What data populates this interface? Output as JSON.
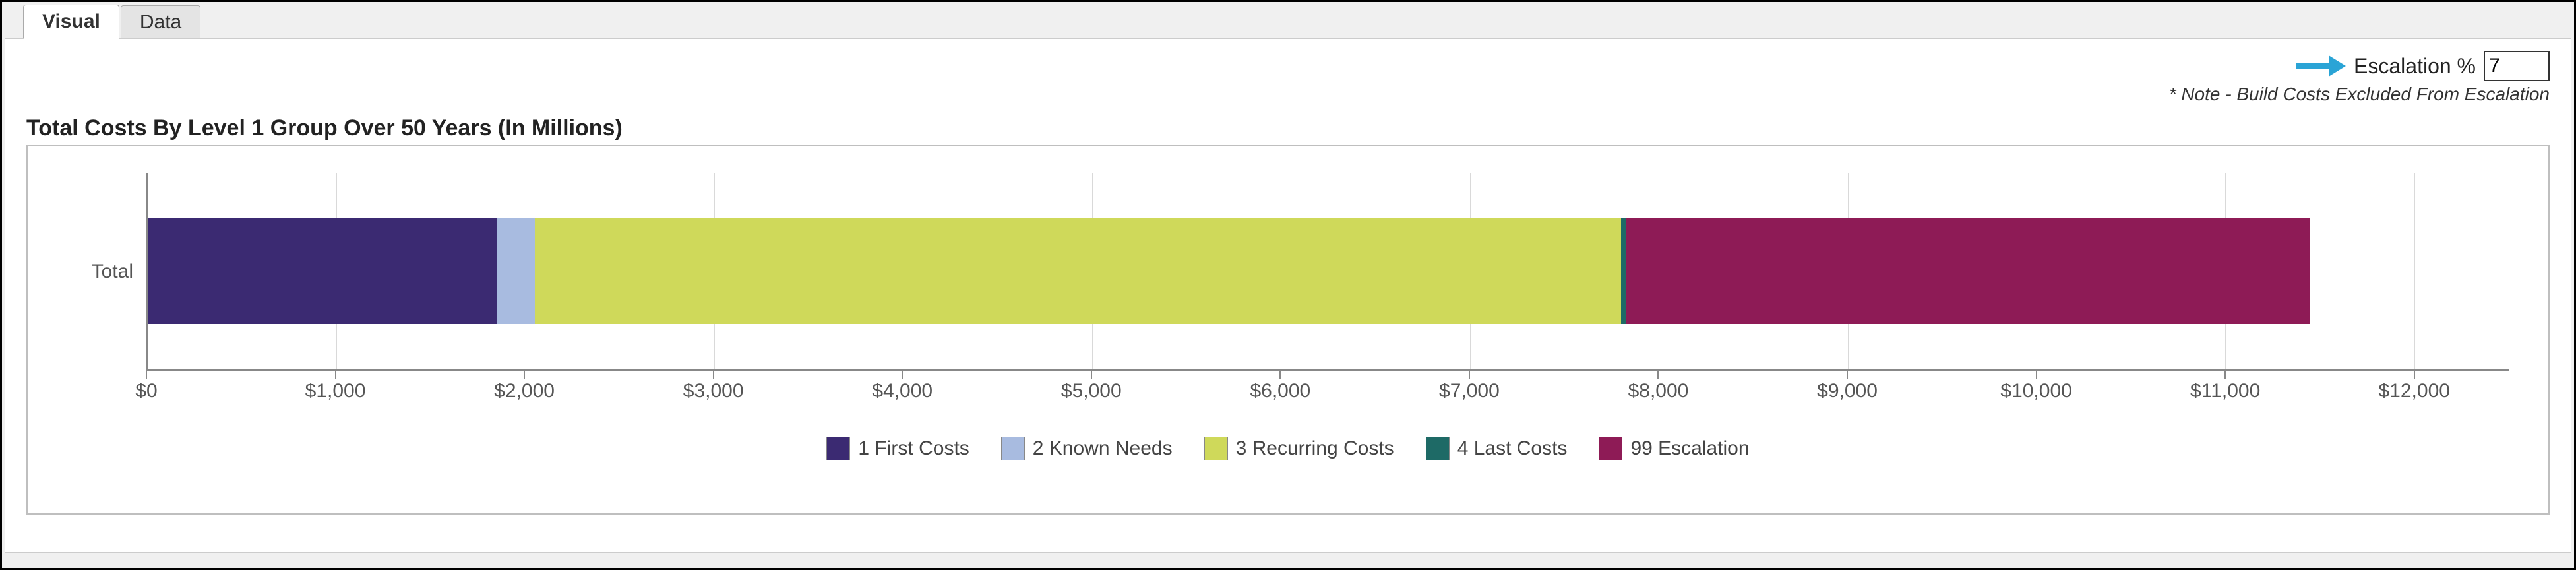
{
  "tabs": {
    "visual": "Visual",
    "data": "Data"
  },
  "controls": {
    "escalation_label": "Escalation %",
    "escalation_value": "7",
    "note": "* Note - Build Costs Excluded From Escalation"
  },
  "chart_title": "Total Costs By Level 1 Group Over 50 Years (In Millions)",
  "chart_data": {
    "type": "bar",
    "orientation": "horizontal",
    "stacked": true,
    "categories": [
      "Total"
    ],
    "series": [
      {
        "name": "1 First Costs",
        "color": "#3b2a72",
        "values": [
          1850
        ]
      },
      {
        "name": "2 Known Needs",
        "color": "#a8bbe0",
        "values": [
          200
        ]
      },
      {
        "name": "3 Recurring Costs",
        "color": "#cfd95a",
        "values": [
          5750
        ]
      },
      {
        "name": "4 Last Costs",
        "color": "#1e6a66",
        "values": [
          30
        ]
      },
      {
        "name": "99 Escalation",
        "color": "#8e1b56",
        "values": [
          3620
        ]
      }
    ],
    "xlabel": "",
    "ylabel": "",
    "xlim": [
      0,
      12500
    ],
    "x_ticks": [
      0,
      1000,
      2000,
      3000,
      4000,
      5000,
      6000,
      7000,
      8000,
      9000,
      10000,
      11000,
      12000
    ],
    "x_tick_labels": [
      "$0",
      "$1,000",
      "$2,000",
      "$3,000",
      "$4,000",
      "$5,000",
      "$6,000",
      "$7,000",
      "$8,000",
      "$9,000",
      "$10,000",
      "$11,000",
      "$12,000"
    ]
  }
}
